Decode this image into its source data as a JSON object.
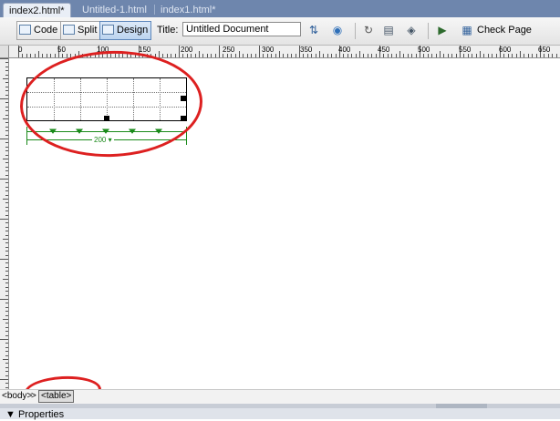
{
  "tabs": [
    {
      "label": "index2.html*",
      "active": true
    },
    {
      "label": "Untitled-1.html",
      "active": false
    },
    {
      "label": "index1.html*",
      "active": false
    }
  ],
  "toolbar": {
    "code_label": "Code",
    "split_label": "Split",
    "design_label": "Design",
    "active_view": "Design",
    "title_label": "Title:",
    "title_value": "Untitled Document",
    "check_page_label": "Check Page"
  },
  "ruler": {
    "ticks": [
      "0",
      "50",
      "100",
      "150",
      "200",
      "250",
      "300",
      "350",
      "400",
      "450",
      "500",
      "550",
      "600",
      "650"
    ]
  },
  "design_table": {
    "columns": 6,
    "rows": 3,
    "width_label": "200 ▾"
  },
  "tag_selector": {
    "body": "<body>",
    "separator": ">",
    "table": "<table>"
  },
  "properties": {
    "label": "▼ Properties"
  },
  "colors": {
    "tabbar": "#6e86ad",
    "annotation": "#dd2020",
    "width_indicator": "#1a8a1a"
  }
}
